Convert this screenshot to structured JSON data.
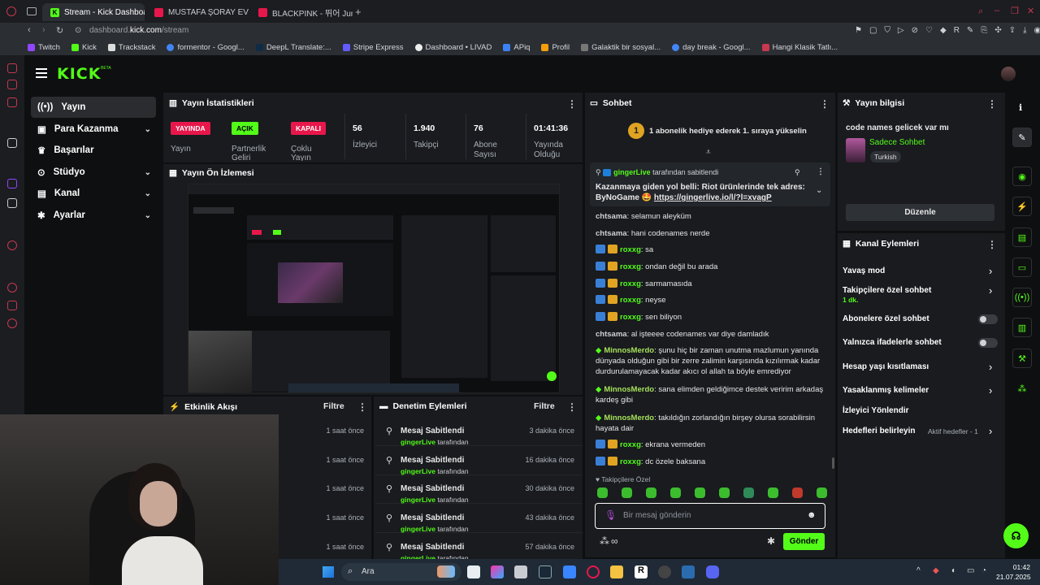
{
  "browser": {
    "tabs": [
      {
        "label": "Stream - Kick Dashboard",
        "active": true
      },
      {
        "label": "MUSTAFA ŞORAY EV ZİY",
        "active": false
      },
      {
        "label": "BLACKPINK - 뛰어 Jump",
        "active": false
      }
    ],
    "url_domain": "dashboard.",
    "url_host": "kick.com",
    "url_path": "/stream",
    "bookmarks": [
      "Twitch",
      "Kick",
      "Trackstack",
      "formentor - Googl...",
      "DeepL Translate:...",
      "Stripe Express",
      "Dashboard • LIVAD",
      "APiq",
      "Profil",
      "Galaktik bir sosyal...",
      "day break - Googl...",
      "Hangi Klasik Tatlı..."
    ]
  },
  "kick": {
    "logo": "KICK",
    "logo_beta": "BETA",
    "nav": [
      {
        "label": "Yayın",
        "icon": "broadcast-icon",
        "has_chevron": false
      },
      {
        "label": "Para Kazanma",
        "icon": "money-icon",
        "has_chevron": true
      },
      {
        "label": "Başarılar",
        "icon": "trophy-icon",
        "has_chevron": false
      },
      {
        "label": "Stüdyo",
        "icon": "studio-icon",
        "has_chevron": true
      },
      {
        "label": "Kanal",
        "icon": "channel-icon",
        "has_chevron": true
      },
      {
        "label": "Ayarlar",
        "icon": "settings-icon",
        "has_chevron": true
      }
    ]
  },
  "stats": {
    "title": "Yayın İstatistikleri",
    "items": [
      {
        "badge": "YAYINDA",
        "label": "Yayın"
      },
      {
        "badge": "AÇIK",
        "label": "Partnerlik Geliri"
      },
      {
        "badge": "KAPALI",
        "label": "Çoklu Yayın"
      },
      {
        "value": "56",
        "label": "İzleyici"
      },
      {
        "value": "1.940",
        "label": "Takipçi"
      },
      {
        "value": "76",
        "label": "Abone Sayısı"
      },
      {
        "value": "01:41:36",
        "label": "Yayında Olduğu"
      }
    ]
  },
  "preview": {
    "title": "Yayın Ön İzlemesi"
  },
  "activity": {
    "title": "Etkinlik Akışı",
    "filter": "Filtre",
    "items": [
      "1 saat önce",
      "1 saat önce",
      "1 saat önce",
      "1 saat önce",
      "1 saat önce"
    ]
  },
  "moderation": {
    "title": "Denetim Eylemleri",
    "filter": "Filtre",
    "items": [
      {
        "title": "Mesaj Sabitlendi",
        "user": "gingerLive",
        "suffix": "tarafından",
        "time": "3 dakika önce"
      },
      {
        "title": "Mesaj Sabitlendi",
        "user": "gingerLive",
        "suffix": "tarafından",
        "time": "16 dakika önce"
      },
      {
        "title": "Mesaj Sabitlendi",
        "user": "gingerLive",
        "suffix": "tarafından",
        "time": "30 dakika önce"
      },
      {
        "title": "Mesaj Sabitlendi",
        "user": "gingerLive",
        "suffix": "tarafından",
        "time": "43 dakika önce"
      },
      {
        "title": "Mesaj Sabitlendi",
        "user": "gingerLive",
        "suffix": "tarafından",
        "time": "57 dakika önce"
      }
    ]
  },
  "chat": {
    "title": "Sohbet",
    "gift_banner_num": "1",
    "gift_banner": "1 abonelik hediye ederek 1. sıraya yükselin",
    "pinned_user": "gingerLive",
    "pinned_suffix": "tarafından sabitlendi",
    "pinned_text": "Kazanmaya giden yol belli: Riot ürünlerinde tek adres: ByNoGame 🤩",
    "pinned_link": "https://gingerlive.io/l/?l=xvagP",
    "messages": [
      {
        "user": "chtsama",
        "text": "selamun aleyküm",
        "badges": false,
        "color": "#cfd1d5"
      },
      {
        "user": "chtsama",
        "text": "hani codenames nerde",
        "badges": false,
        "color": "#cfd1d5"
      },
      {
        "user": "roxxg",
        "text": "sa",
        "badges": true,
        "color": "#53fc18"
      },
      {
        "user": "roxxg",
        "text": "ondan değil bu arada",
        "badges": true,
        "color": "#53fc18"
      },
      {
        "user": "roxxg",
        "text": "sarmamasıda",
        "badges": true,
        "color": "#53fc18"
      },
      {
        "user": "roxxg",
        "text": "neyse",
        "badges": true,
        "color": "#53fc18"
      },
      {
        "user": "roxxg",
        "text": "sen biliyon",
        "badges": true,
        "color": "#53fc18"
      },
      {
        "user": "chtsama",
        "text": "al işteeee codenames var diye damladık",
        "badges": false,
        "color": "#cfd1d5"
      },
      {
        "user": "MinnosMerdo",
        "text": "şunu hiç bir zaman unutma mazlumun yanında dünyada olduğun gibi bir zerre zalimin karşısında kızılırmak kadar durdurulamayacak kadar akıcı ol allah ta böyle emrediyor",
        "badges": false,
        "color": "#a6e05a"
      },
      {
        "user": "MinnosMerdo",
        "text": "sana elimden geldiğimce destek veririm arkadaş kardeş gibi",
        "badges": false,
        "color": "#a6e05a"
      },
      {
        "user": "MinnosMerdo",
        "text": "takıldığın zorlandığın birşey olursa sorabilirsin hayata dair",
        "badges": false,
        "color": "#a6e05a"
      },
      {
        "user": "roxxg",
        "text": "ekrana vermeden",
        "badges": true,
        "color": "#53fc18"
      },
      {
        "user": "roxxg",
        "text": "dc özele baksana",
        "badges": true,
        "color": "#53fc18"
      }
    ],
    "follower_only": "Takipçilere Özel",
    "input_placeholder": "Bir mesaj gönderin",
    "send": "Gönder"
  },
  "info": {
    "title": "Yayın bilgisi",
    "stream_title": "code names gelicek var mı",
    "category": "Sadece Sohbet",
    "tag": "Turkish",
    "edit": "Düzenle"
  },
  "actions": {
    "title": "Kanal Eylemleri",
    "items": [
      {
        "label": "Yavaş mod",
        "control": "chevron"
      },
      {
        "label": "Takipçilere özel sohbet",
        "sub": "1 dk.",
        "control": "chevron"
      },
      {
        "label": "Abonelere özel sohbet",
        "control": "toggle"
      },
      {
        "label": "Yalnızca ifadelerle sohbet",
        "control": "toggle"
      },
      {
        "label": "Hesap yaşı kısıtlaması",
        "control": "chevron"
      },
      {
        "label": "Yasaklanmış kelimeler",
        "control": "chevron"
      },
      {
        "label": "İzleyici Yönlendir",
        "control": "none"
      },
      {
        "label": "Hedefleri belirleyin",
        "extra": "Aktif hedefler - 1",
        "control": "chevron"
      }
    ]
  },
  "taskbar": {
    "search": "Ara",
    "time": "01:42",
    "date": "21.07.2025"
  },
  "colors": {
    "kick_green": "#53fc18",
    "live_red": "#e8174b",
    "panel": "#191b1f",
    "background": "#0e0f10"
  }
}
